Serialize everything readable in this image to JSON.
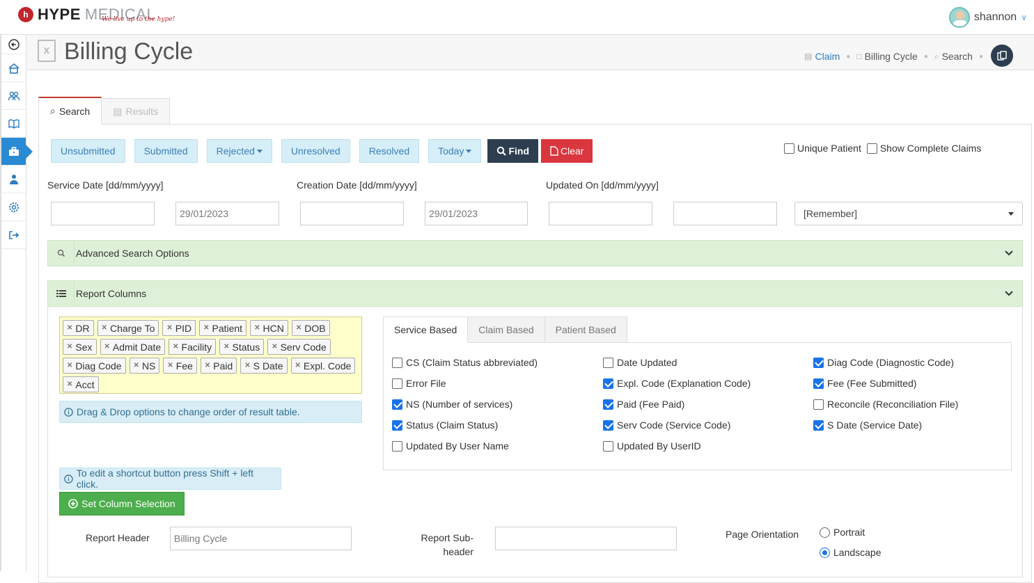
{
  "app": {
    "logo_mark": "h",
    "brand_bold": "HYPE",
    "brand_light": "MEDICAL",
    "tagline": "We live up to the hype!"
  },
  "user": {
    "name": "shannon"
  },
  "header": {
    "title": "Billing Cycle",
    "page_icon_glyph": "x",
    "breadcrumbs": [
      "Claim",
      "Billing Cycle",
      "Search"
    ]
  },
  "tabs": [
    "Search",
    "Results"
  ],
  "quick_buttons": {
    "unsubmitted": "Unsubmitted",
    "submitted": "Submitted",
    "rejected": "Rejected",
    "unresolved": "Unresolved",
    "resolved": "Resolved",
    "today": "Today",
    "find": "Find",
    "clear": "Clear"
  },
  "top_checks": {
    "unique_patient": "Unique Patient",
    "show_complete": "Show Complete Claims"
  },
  "filters": {
    "service_date_label": "Service Date [dd/mm/yyyy]",
    "creation_date_label": "Creation Date [dd/mm/yyyy]",
    "updated_on_label": "Updated On [dd/mm/yyyy]",
    "service_from": "",
    "service_to": "29/01/2023",
    "creation_from": "",
    "creation_to": "29/01/2023",
    "updated_from": "",
    "updated_to": "",
    "remember_select": "[Remember]"
  },
  "advanced": {
    "title": "Advanced Search Options"
  },
  "report_columns": {
    "title": "Report Columns",
    "chips": [
      "DR",
      "Charge To",
      "PID",
      "Patient",
      "HCN",
      "DOB",
      "Sex",
      "Admit Date",
      "Facility",
      "Status",
      "Serv Code",
      "Diag Code",
      "NS",
      "Fee",
      "Paid",
      "S Date",
      "Expl. Code",
      "Acct"
    ],
    "drag_info": "Drag & Drop options to change order of result table.",
    "shortcut_info": "To edit a shortcut button press Shift + left click.",
    "set_button": "Set Column Selection",
    "col_tabs": [
      "Service Based",
      "Claim Based",
      "Patient Based"
    ],
    "options": [
      {
        "label": "CS (Claim Status abbreviated)",
        "checked": false
      },
      {
        "label": "Error File",
        "checked": false
      },
      {
        "label": "NS (Number of services)",
        "checked": true
      },
      {
        "label": "Status (Claim Status)",
        "checked": true
      },
      {
        "label": "Updated By User Name",
        "checked": false
      },
      {
        "label": "Date Updated",
        "checked": false
      },
      {
        "label": "Expl. Code (Explanation Code)",
        "checked": true
      },
      {
        "label": "Paid (Fee Paid)",
        "checked": true
      },
      {
        "label": "Serv Code (Service Code)",
        "checked": true
      },
      {
        "label": "Updated By UserID",
        "checked": false
      },
      {
        "label": "Diag Code (Diagnostic Code)",
        "checked": true
      },
      {
        "label": "Fee (Fee Submitted)",
        "checked": true
      },
      {
        "label": "Reconcile (Reconciliation File)",
        "checked": false
      },
      {
        "label": "S Date (Service Date)",
        "checked": true
      }
    ]
  },
  "report": {
    "header_label": "Report Header",
    "header_value": "Billing Cycle",
    "subheader_label_1": "Report Sub-",
    "subheader_label_2": "header",
    "subheader_value": "",
    "orientation_label": "Page Orientation",
    "portrait": "Portrait",
    "landscape": "Landscape",
    "orientation_selected": "Landscape"
  },
  "colors": {
    "accent": "#2a8ad4",
    "quick_btn_bg": "#d6eef7",
    "find_bg": "#2c3e50",
    "clear_bg": "#d9363e",
    "accordion_bg": "#dff0d8",
    "set_btn_bg": "#4cae4c",
    "chip_area_bg": "#ffffcc"
  }
}
